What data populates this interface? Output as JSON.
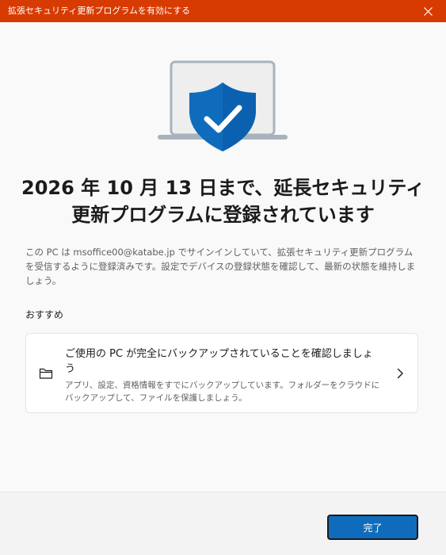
{
  "window": {
    "title": "拡張セキュリティ更新プログラムを有効にする"
  },
  "colors": {
    "title_bar": "#d83b01",
    "accent": "#0f6cbd",
    "shield": "#0f6cbd"
  },
  "icons": {
    "close": "close-icon",
    "hero": "laptop-shield-check-icon",
    "card": "folder-icon",
    "card_chevron": "chevron-right-icon"
  },
  "main": {
    "headline": "2026 年 10 月 13 日まで、延長セキュリティ更新プログラムに登録されています",
    "description": "この PC は msoffice00@katabe.jp でサインインしていて、拡張セキュリティ更新プログラムを受信するように登録済みです。設定でデバイスの登録状態を確認して、最新の状態を維持しましょう。",
    "section_label": "おすすめ",
    "recommendation": {
      "title": "ご使用の PC が完全にバックアップされていることを確認しましょう",
      "description": "アプリ、設定、資格情報をすでにバックアップしています。フォルダーをクラウドにバックアップして、ファイルを保護しましょう。"
    }
  },
  "footer": {
    "done_label": "完了"
  }
}
